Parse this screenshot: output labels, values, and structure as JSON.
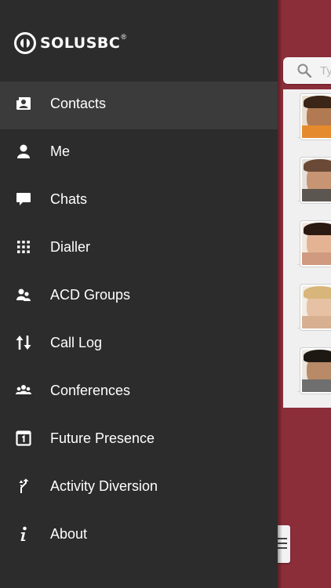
{
  "app": {
    "brand": "SOLUSBC",
    "brand_mark": "®"
  },
  "menu": {
    "items": [
      {
        "label": "Contacts",
        "icon": "contacts-icon",
        "active": true
      },
      {
        "label": "Me",
        "icon": "person-icon"
      },
      {
        "label": "Chats",
        "icon": "chat-bubble-icon"
      },
      {
        "label": "Dialler",
        "icon": "keypad-icon"
      },
      {
        "label": "ACD Groups",
        "icon": "acd-group-icon"
      },
      {
        "label": "Call Log",
        "icon": "call-log-arrows-icon"
      },
      {
        "label": "Conferences",
        "icon": "conference-icon"
      },
      {
        "label": "Future Presence",
        "icon": "calendar-icon"
      },
      {
        "label": "Activity Diversion",
        "icon": "diversion-arrow-icon"
      },
      {
        "label": "About",
        "icon": "info-icon"
      }
    ]
  },
  "search": {
    "placeholder": "Ty"
  },
  "colors": {
    "drawer": "#2c2c2c",
    "active_row": "#3b3b3b",
    "accent": "#8c2e3a"
  }
}
